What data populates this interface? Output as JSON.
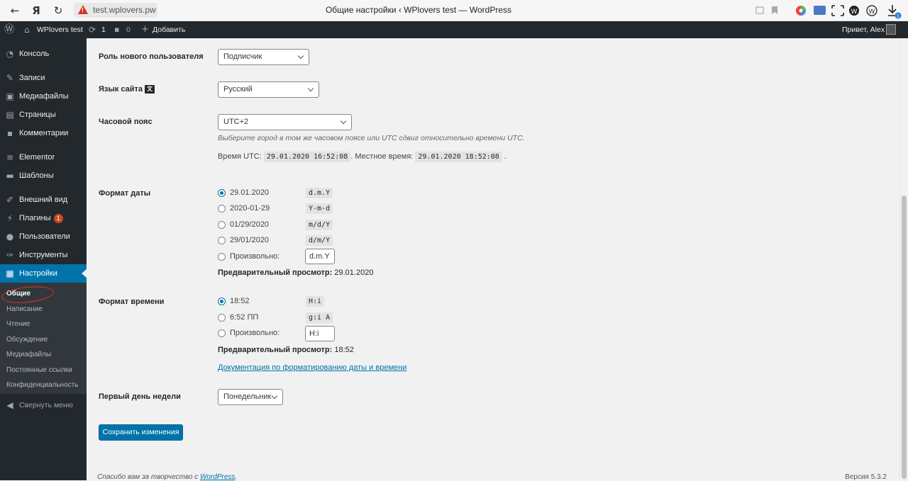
{
  "browser": {
    "url": "test.wplovers.pw",
    "title": "Общие настройки ‹ WPlovers test — WordPress",
    "back_icon": "←",
    "yandex_icon": "Я",
    "reload_icon": "↻",
    "download_badge": "1"
  },
  "adminbar": {
    "site": "WPlovers test",
    "updates": "1",
    "comments": "0",
    "add": "Добавить",
    "greeting": "Привет, Alex"
  },
  "menu": {
    "console": "Консоль",
    "posts": "Записи",
    "media": "Медиафайлы",
    "pages": "Страницы",
    "comments": "Комментарии",
    "elementor": "Elementor",
    "templates": "Шаблоны",
    "appearance": "Внешний вид",
    "plugins": "Плагины",
    "plugins_badge": "1",
    "users": "Пользователи",
    "tools": "Инструменты",
    "settings": "Настройки",
    "collapse": "Свернуть меню"
  },
  "submenu": {
    "general": "Общие",
    "writing": "Написание",
    "reading": "Чтение",
    "discussion": "Обсуждение",
    "media": "Медиафайлы",
    "permalinks": "Постоянные ссылки",
    "privacy": "Конфиденциальность"
  },
  "settings": {
    "role_label": "Роль нового пользователя",
    "role_value": "Подписчик",
    "lang_label": "Язык сайта",
    "lang_value": "Русский",
    "tz_label": "Часовой пояс",
    "tz_value": "UTC+2",
    "tz_desc": "Выберите город в том же часовом поясе или UTC сдвиг относительно времени UTC.",
    "utc_label": "Время UTC:",
    "utc_value": "29.01.2020 16:52:08",
    "local_label": ". Местное время:",
    "local_value": "29.01.2020 18:52:08",
    "dot": ".",
    "date_label": "Формат даты",
    "date_options": [
      {
        "text": "29.01.2020",
        "fmt": "d.m.Y"
      },
      {
        "text": "2020-01-29",
        "fmt": "Y-m-d"
      },
      {
        "text": "01/29/2020",
        "fmt": "m/d/Y"
      },
      {
        "text": "29/01/2020",
        "fmt": "d/m/Y"
      }
    ],
    "date_custom_label": "Произвольно:",
    "date_custom_value": "d.m.Y",
    "date_preview_label": "Предварительный просмотр:",
    "date_preview_value": " 29.01.2020",
    "time_label": "Формат времени",
    "time_options": [
      {
        "text": "18:52",
        "fmt": "H:i"
      },
      {
        "text": "6:52 ПП",
        "fmt": "g:i A"
      }
    ],
    "time_custom_label": "Произвольно:",
    "time_custom_value": "H:i",
    "time_preview_label": "Предварительный просмотр:",
    "time_preview_value": " 18:52",
    "doc_link": "Документация по форматированию даты и времени",
    "doc_dot": ".",
    "week_label": "Первый день недели",
    "week_value": "Понедельник",
    "save": "Сохранить изменения"
  },
  "footer": {
    "thanks": "Спасибо вам за творчество с ",
    "wp": "WordPress",
    "dot": ".",
    "version": "Версия 5.3.2"
  }
}
